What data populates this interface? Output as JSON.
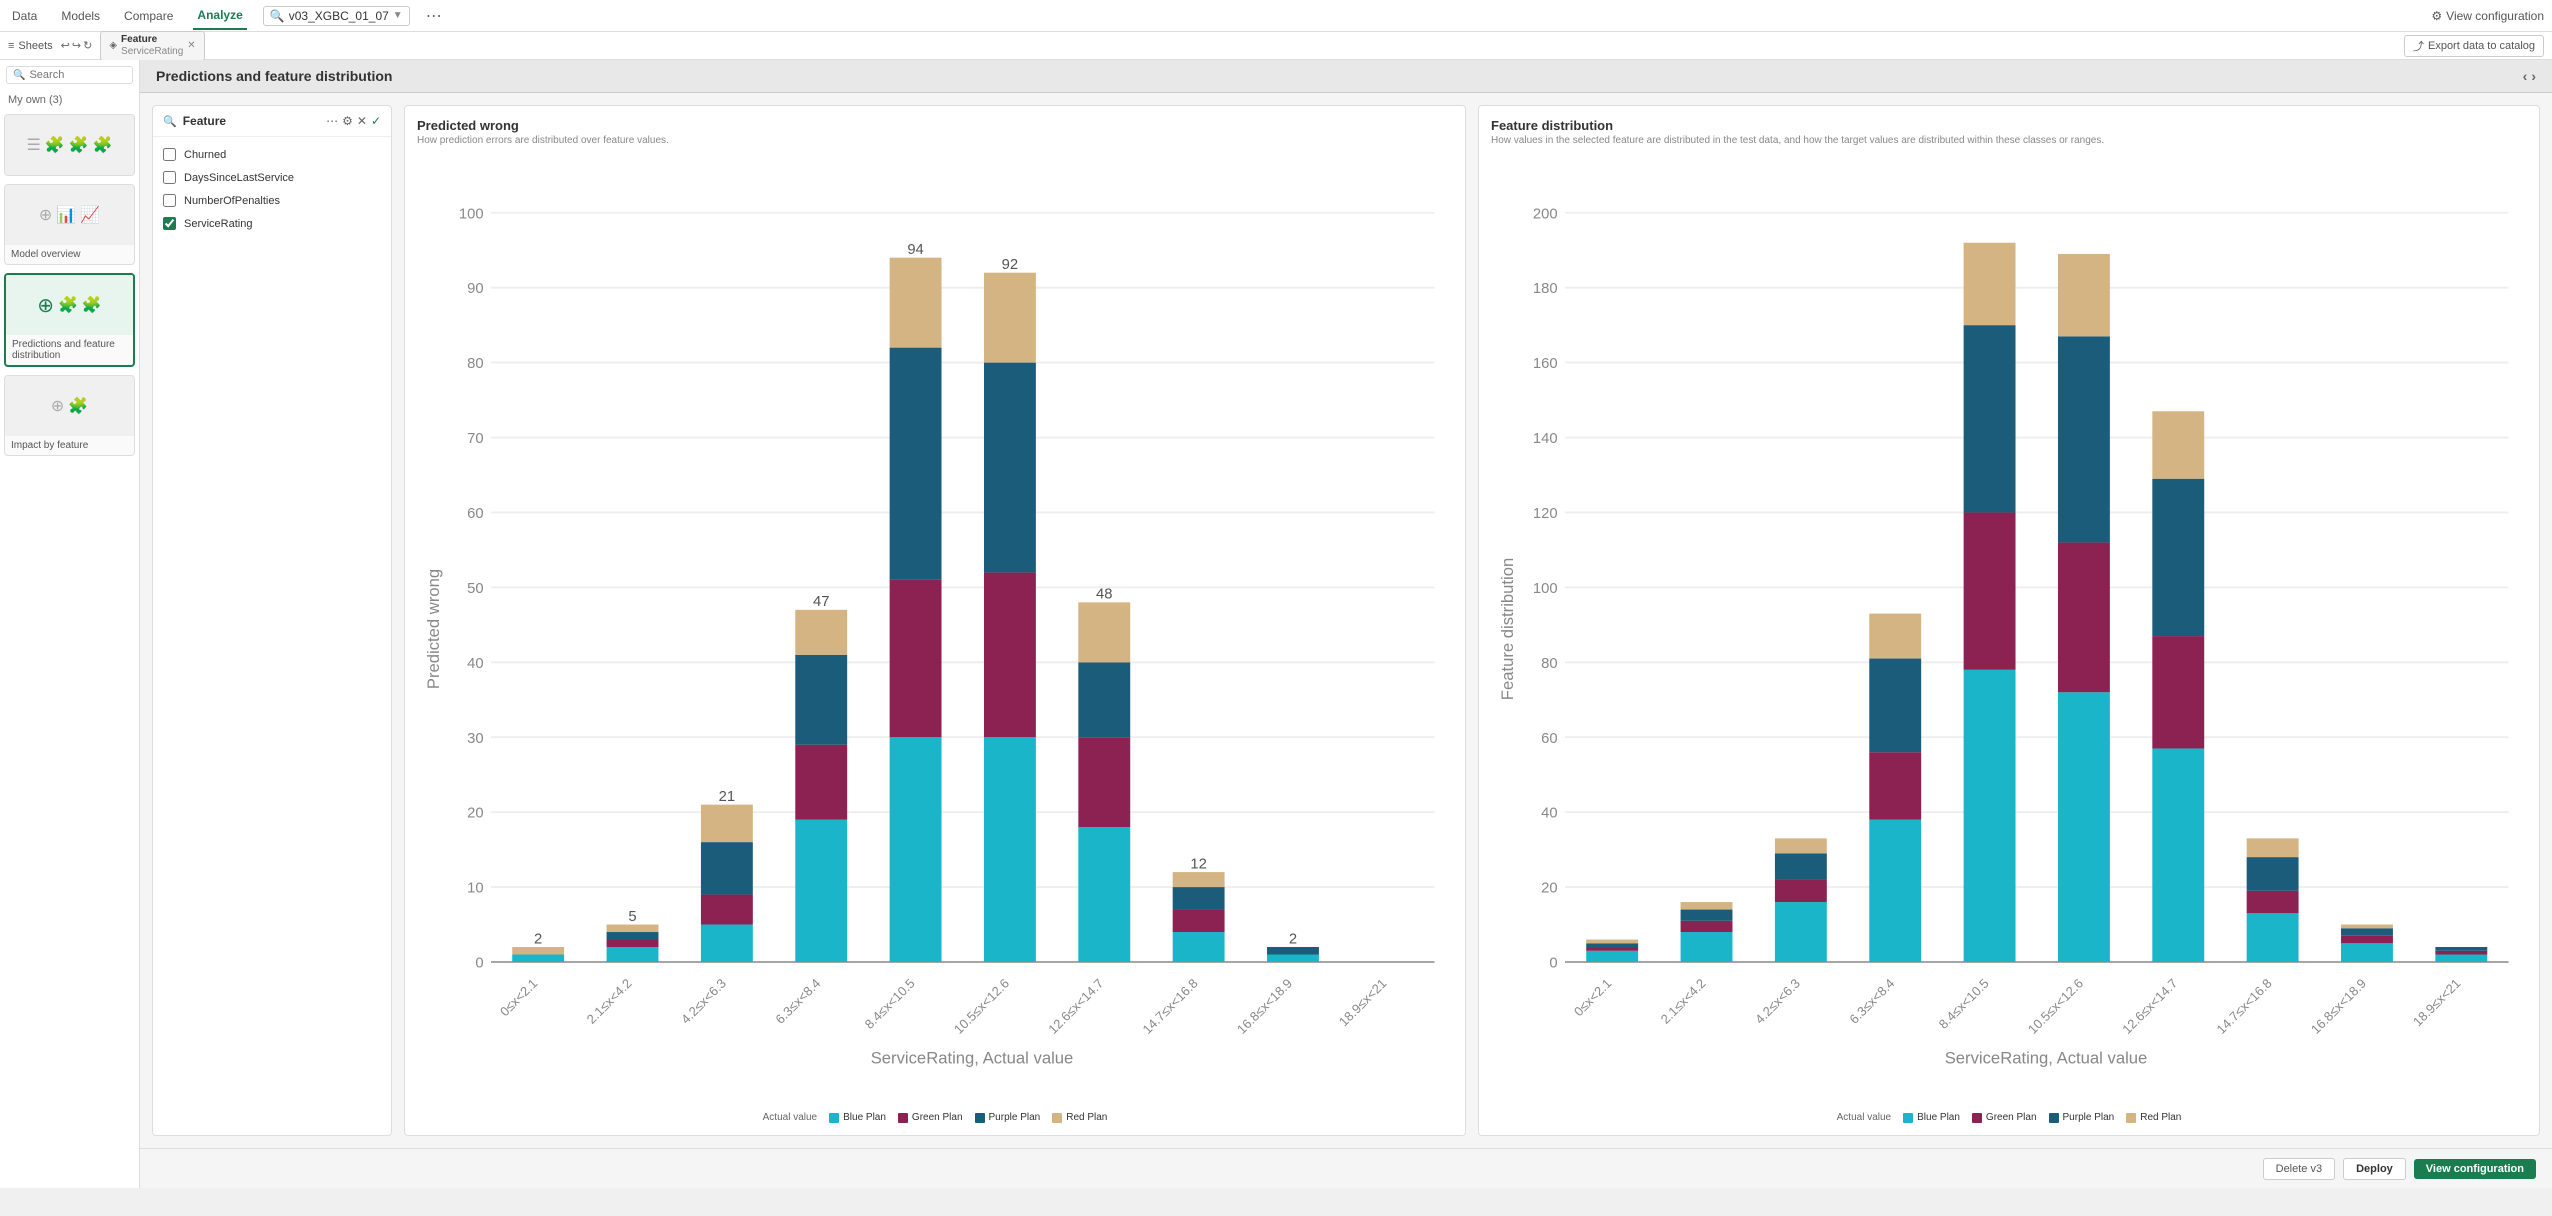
{
  "nav": {
    "items": [
      "Data",
      "Models",
      "Compare",
      "Analyze"
    ],
    "active": "Analyze",
    "search_value": "v03_XGBC_01_07",
    "more_icon": "⋯"
  },
  "top_right": {
    "view_config_label": "View configuration"
  },
  "second_bar": {
    "tab_label_line1": "Feature",
    "tab_label_line2": "ServiceRating",
    "export_label": "Export data to catalog"
  },
  "sidebar": {
    "search_placeholder": "Search",
    "section_label": "My own (3)",
    "cards": [
      {
        "id": "card1",
        "label": "",
        "type": "placeholder"
      },
      {
        "id": "card2",
        "label": "Model overview",
        "type": "model"
      },
      {
        "id": "card3",
        "label": "Predictions and feature distribution",
        "type": "predictions",
        "active": true
      },
      {
        "id": "card4",
        "label": "Impact by feature",
        "type": "impact"
      }
    ]
  },
  "page": {
    "title": "Predictions and feature distribution"
  },
  "feature_panel": {
    "title": "Feature",
    "features": [
      {
        "id": "churned",
        "label": "Churned",
        "checked": false
      },
      {
        "id": "days_since",
        "label": "DaysSinceLastService",
        "checked": false
      },
      {
        "id": "penalties",
        "label": "NumberOfPenalties",
        "checked": false
      },
      {
        "id": "service_rating",
        "label": "ServiceRating",
        "checked": true
      }
    ]
  },
  "chart_left": {
    "title": "Predicted wrong",
    "subtitle": "How prediction errors are distributed over feature values.",
    "y_axis_label": "Predicted wrong",
    "x_axis_label": "ServiceRating, Actual value",
    "y_max": 100,
    "y_ticks": [
      0,
      10,
      20,
      30,
      40,
      50,
      60,
      70,
      80,
      90,
      100
    ],
    "x_categories": [
      "0≤x<2.1",
      "2.1≤x<4.2",
      "4.2≤x<6.3",
      "6.3≤x<8.4",
      "8.4≤x<10.5",
      "10.5≤x<12.6",
      "12.6≤x<14.7",
      "14.7≤x<16.8",
      "16.8≤x<18.9",
      "18.9≤x<21"
    ],
    "bar_totals": [
      2,
      5,
      21,
      47,
      94,
      92,
      48,
      12,
      2,
      0
    ],
    "bars": [
      {
        "blue": 1,
        "green": 0,
        "purple": 0,
        "red": 1
      },
      {
        "blue": 2,
        "green": 1,
        "purple": 1,
        "red": 1
      },
      {
        "blue": 5,
        "green": 4,
        "purple": 7,
        "red": 5
      },
      {
        "blue": 19,
        "green": 10,
        "purple": 12,
        "red": 6
      },
      {
        "blue": 30,
        "green": 21,
        "purple": 31,
        "red": 12
      },
      {
        "blue": 30,
        "green": 22,
        "purple": 28,
        "red": 12
      },
      {
        "blue": 18,
        "green": 12,
        "purple": 10,
        "red": 8
      },
      {
        "blue": 4,
        "green": 3,
        "purple": 3,
        "red": 2
      },
      {
        "blue": 1,
        "green": 0,
        "purple": 1,
        "red": 0
      },
      {
        "blue": 0,
        "green": 0,
        "purple": 0,
        "red": 0
      }
    ]
  },
  "chart_right": {
    "title": "Feature distribution",
    "subtitle": "How values in the selected feature are distributed in the test data, and how the target values are distributed within these classes or ranges.",
    "y_axis_label": "Feature distribution",
    "x_axis_label": "ServiceRating, Actual value",
    "y_max": 200,
    "y_ticks": [
      0,
      20,
      40,
      60,
      80,
      100,
      120,
      140,
      160,
      180,
      200
    ],
    "x_categories": [
      "0≤x<2.1",
      "2.1≤x<4.2",
      "4.2≤x<6.3",
      "6.3≤x<8.4",
      "8.4≤x<10.5",
      "10.5≤x<12.6",
      "12.6≤x<14.7",
      "14.7≤x<16.8",
      "16.8≤x<18.9",
      "18.9≤x<21"
    ],
    "bars": [
      {
        "blue": 2,
        "green": 1,
        "purple": 1,
        "red": 1
      },
      {
        "blue": 7,
        "green": 3,
        "purple": 3,
        "red": 2
      },
      {
        "blue": 15,
        "green": 6,
        "purple": 7,
        "red": 4
      },
      {
        "blue": 35,
        "green": 18,
        "purple": 25,
        "red": 12
      },
      {
        "blue": 75,
        "green": 40,
        "purple": 50,
        "red": 22
      },
      {
        "blue": 70,
        "green": 38,
        "purple": 55,
        "red": 22
      },
      {
        "blue": 55,
        "green": 28,
        "purple": 40,
        "red": 18
      },
      {
        "blue": 12,
        "green": 6,
        "purple": 9,
        "red": 5
      },
      {
        "blue": 4,
        "green": 2,
        "purple": 2,
        "red": 1
      },
      {
        "blue": 2,
        "green": 1,
        "purple": 1,
        "red": 0
      }
    ]
  },
  "legend": {
    "actual_value_label": "Actual value",
    "items": [
      {
        "id": "blue",
        "label": "Blue Plan",
        "color": "#1a8fa0"
      },
      {
        "id": "green",
        "label": "Green Plan",
        "color": "#7b2455"
      },
      {
        "id": "purple",
        "label": "Purple Plan",
        "color": "#1a5c7a"
      },
      {
        "id": "red",
        "label": "Red Plan",
        "color": "#d4b483"
      }
    ]
  },
  "bottom_bar": {
    "delete_label": "Delete v3",
    "deploy_label": "Deploy",
    "view_config_label": "View configuration"
  },
  "colors": {
    "blue_plan": "#1ab5c8",
    "green_plan": "#8b2252",
    "purple_plan": "#1a5c7a",
    "red_plan": "#d4b483",
    "accent": "#1a7c4f"
  }
}
